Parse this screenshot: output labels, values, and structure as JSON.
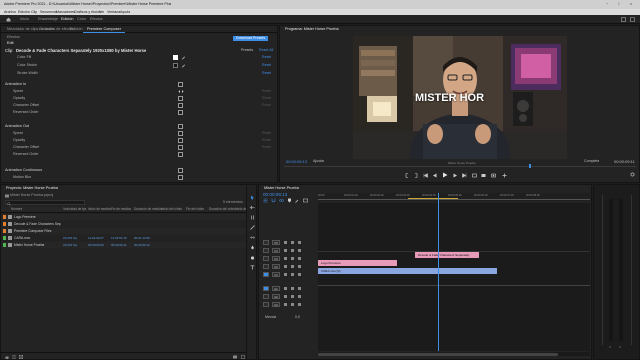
{
  "app": {
    "title": "Adobe Premiere Pro 2021 - D:\\\\Usuarios\\\\Mister Horse\\\\Proyectos\\\\Premiere\\\\Mister Horse Premiere Plus",
    "window_controls": [
      "−",
      "□",
      "×"
    ]
  },
  "menu": {
    "items": [
      "Archivo",
      "Edición",
      "Clip",
      "Secuencia",
      "Marcadores",
      "Gráficos y títulos",
      "Ver",
      "Ventana",
      "Ayuda"
    ]
  },
  "workspace": {
    "tabs": [
      "Inicio",
      "Ensamblaje",
      "Edición",
      "Color",
      "Efectos"
    ],
    "active": "Edición"
  },
  "effect_controls": {
    "tabs": [
      "Mezclador de clips de audio",
      "Controles de efectos",
      "Edición",
      "Premiere Composer"
    ],
    "active_tab": "Premiere Composer",
    "subtabs": [
      "Efectos",
      "Edit"
    ],
    "clip_prefix": "Clip:",
    "clip_title": "Decode & Fade Characters Separately 1920x1080 by Mister Horse",
    "presets_btn": "Presets",
    "download_btn": "Download Presets",
    "reset_all": "Reset All",
    "rows_top": [
      {
        "label": "Color Fill"
      },
      {
        "label": "Color Stroke"
      },
      {
        "label": "Stroke Width"
      }
    ],
    "reset_text": "Reset",
    "sections": [
      {
        "title": "Animation In",
        "params": [
          "Speed",
          "Opacity",
          "Character Offset",
          "Reversed Order"
        ]
      },
      {
        "title": "Animation Out",
        "params": [
          "Speed",
          "Opacity",
          "Character Offset",
          "Reversed Order"
        ]
      },
      {
        "title": "Animation Continuous",
        "params": [
          "Motion Blur"
        ]
      }
    ]
  },
  "program_monitor": {
    "tab": "Programa: Mister Horse Prueba",
    "overlay_text": "MISTER HOR",
    "caption": "Mister Horse Prueba",
    "timecode_left": "00:00:06:13",
    "fit": "Ajustar",
    "quality": "Completa",
    "timecode_right": "00:00:09:11"
  },
  "project_panel": {
    "tab": "Proyecto: Mister Horse Prueba",
    "file": "Mister Horse Prueba.prproj",
    "count": "5 elementos",
    "columns": [
      "Nombre",
      "Velocidad de fps",
      "Inicio de medios",
      "Fin de medios",
      "Duración de medios",
      "Inicio del vídeo",
      "Fin del vídeo",
      "Duración del vídeo",
      "Inicio de audio"
    ],
    "rows": [
      {
        "name": "Logo Premiere",
        "color": "#e07f2f",
        "cells": [
          "",
          "",
          "",
          "",
          "",
          "",
          "",
          ""
        ]
      },
      {
        "name": "Decode & Fade Characters Separately",
        "color": "#e07f2f",
        "cells": [
          "",
          "",
          "",
          "",
          "",
          "",
          "",
          ""
        ]
      },
      {
        "name": "Premiere Composer Files",
        "color": "#e07f2f",
        "cells": [
          "",
          "",
          "",
          "",
          "",
          "",
          "",
          ""
        ]
      },
      {
        "name": "CARA.mov",
        "color": "#52b352",
        "cells": [
          "23,976 fps",
          "11:22:39:07",
          "11:23:51:15",
          "00:01:12:09",
          "",
          "",
          "",
          ""
        ]
      },
      {
        "name": "Mister Horse Prueba",
        "color": "#52b352",
        "cells": [
          "23,976 fps",
          "00:00:00:00",
          "00:00:09:11",
          "00:00:09:12",
          "",
          "",
          "",
          ""
        ]
      }
    ]
  },
  "timeline": {
    "tab": "Mister Horse Prueba",
    "timecode": "00:00:06:13",
    "tracks": [
      {
        "name": "V5"
      },
      {
        "name": "V4"
      },
      {
        "name": "V3"
      },
      {
        "name": "V2"
      },
      {
        "name": "V1"
      },
      {
        "name": "A1"
      },
      {
        "name": "A2"
      },
      {
        "name": "A3"
      }
    ],
    "master": "Mezcla",
    "master_value": "0,0",
    "ruler": [
      "00:00",
      "00:00:01:00",
      "00:00:02:00",
      "00:00:03:00",
      "00:00:04:00",
      "00:00:05:00",
      "00:00:06:00",
      "00:00:07:00",
      "00:00:08:00"
    ],
    "clips": [
      {
        "label": "Decode & Fade Characters Separately",
        "track": "V3",
        "color": "#e79bb8"
      },
      {
        "label": "Logo Premiere",
        "track": "V2",
        "color": "#e79bb8"
      },
      {
        "label": "CARA.mov [V]",
        "track": "V1",
        "color": "#8aa6e0"
      }
    ]
  },
  "colors": {
    "accent": "#3f8ee6",
    "playhead": "#3f8ee6",
    "clip_pink": "#e79bb8",
    "clip_blue": "#8aa6e0"
  }
}
